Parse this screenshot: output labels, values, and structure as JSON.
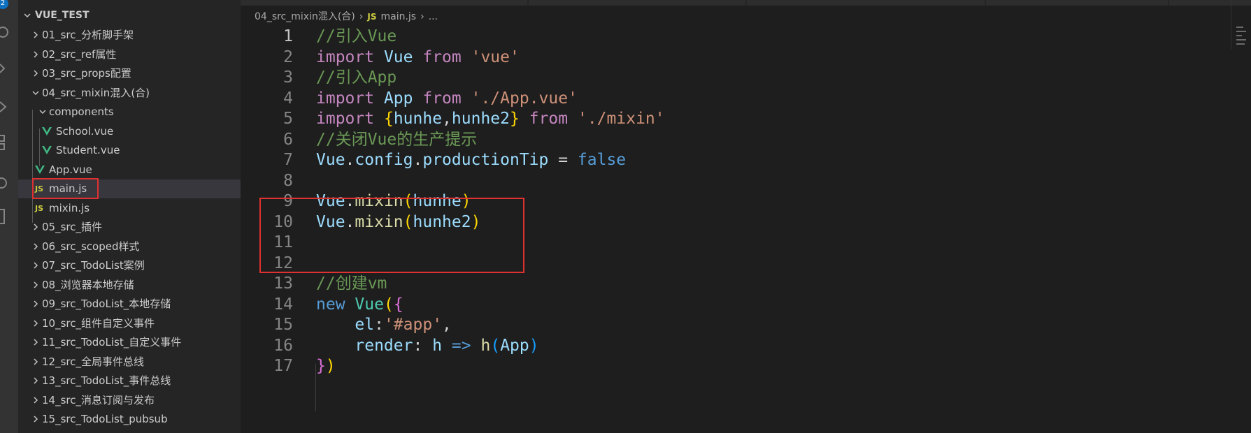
{
  "activity_bar": {
    "badge": "2",
    "icons": [
      "search-icon",
      "source-control-icon",
      "run-debug-icon",
      "extensions-icon",
      "remote-icon",
      "testing-icon"
    ]
  },
  "explorer": {
    "root": "VUE_TEST",
    "items": [
      {
        "label": "01_src_分析脚手架",
        "type": "folder"
      },
      {
        "label": "02_src_ref属性",
        "type": "folder"
      },
      {
        "label": "03_src_props配置",
        "type": "folder"
      },
      {
        "label": "04_src_mixin混入(合)",
        "type": "folder-open"
      },
      {
        "label": "components",
        "type": "folder-open"
      },
      {
        "label": "School.vue",
        "type": "vue"
      },
      {
        "label": "Student.vue",
        "type": "vue"
      },
      {
        "label": "App.vue",
        "type": "vue"
      },
      {
        "label": "main.js",
        "type": "js",
        "selected": true
      },
      {
        "label": "mixin.js",
        "type": "js"
      },
      {
        "label": "05_src_插件",
        "type": "folder"
      },
      {
        "label": "06_src_scoped样式",
        "type": "folder"
      },
      {
        "label": "07_src_TodoList案例",
        "type": "folder"
      },
      {
        "label": "08_浏览器本地存储",
        "type": "folder"
      },
      {
        "label": "09_src_TodoList_本地存储",
        "type": "folder"
      },
      {
        "label": "10_src_组件自定义事件",
        "type": "folder"
      },
      {
        "label": "11_src_TodoList_自定义事件",
        "type": "folder"
      },
      {
        "label": "12_src_全局事件总线",
        "type": "folder"
      },
      {
        "label": "13_src_TodoList_事件总线",
        "type": "folder"
      },
      {
        "label": "14_src_消息订阅与发布",
        "type": "folder"
      },
      {
        "label": "15_src_TodoList_pubsub",
        "type": "folder"
      }
    ],
    "js_icon_text": "JS"
  },
  "breadcrumb": {
    "folder": "04_src_mixin混入(合)",
    "file_icon": "JS",
    "file": "main.js",
    "symbol": "..."
  },
  "editor": {
    "language": "javascript",
    "active_line": "1",
    "line_numbers": [
      "1",
      "2",
      "3",
      "4",
      "5",
      "6",
      "7",
      "8",
      "9",
      "10",
      "11",
      "12",
      "13",
      "14",
      "15",
      "16",
      "17"
    ],
    "lines": [
      [
        {
          "t": "//引入Vue",
          "c": "comment"
        }
      ],
      [
        {
          "t": "import",
          "c": "import"
        },
        {
          "t": " ",
          "c": "plain"
        },
        {
          "t": "Vue",
          "c": "var"
        },
        {
          "t": " ",
          "c": "plain"
        },
        {
          "t": "from",
          "c": "import"
        },
        {
          "t": " ",
          "c": "plain"
        },
        {
          "t": "'vue'",
          "c": "string"
        }
      ],
      [
        {
          "t": "//引入App",
          "c": "comment"
        }
      ],
      [
        {
          "t": "import",
          "c": "import"
        },
        {
          "t": " ",
          "c": "plain"
        },
        {
          "t": "App",
          "c": "var"
        },
        {
          "t": " ",
          "c": "plain"
        },
        {
          "t": "from",
          "c": "import"
        },
        {
          "t": " ",
          "c": "plain"
        },
        {
          "t": "'./App.vue'",
          "c": "string"
        }
      ],
      [
        {
          "t": "import",
          "c": "import"
        },
        {
          "t": " ",
          "c": "plain"
        },
        {
          "t": "{",
          "c": "brace1"
        },
        {
          "t": "hunhe",
          "c": "var"
        },
        {
          "t": ",",
          "c": "plain"
        },
        {
          "t": "hunhe2",
          "c": "var"
        },
        {
          "t": "}",
          "c": "brace1"
        },
        {
          "t": " ",
          "c": "plain"
        },
        {
          "t": "from",
          "c": "import"
        },
        {
          "t": " ",
          "c": "plain"
        },
        {
          "t": "'./mixin'",
          "c": "string"
        }
      ],
      [
        {
          "t": "//关闭Vue的生产提示",
          "c": "comment"
        }
      ],
      [
        {
          "t": "Vue",
          "c": "var"
        },
        {
          "t": ".",
          "c": "plain"
        },
        {
          "t": "config",
          "c": "var"
        },
        {
          "t": ".",
          "c": "plain"
        },
        {
          "t": "productionTip",
          "c": "var"
        },
        {
          "t": " = ",
          "c": "plain"
        },
        {
          "t": "false",
          "c": "bool"
        }
      ],
      [],
      [
        {
          "t": "Vue",
          "c": "var"
        },
        {
          "t": ".",
          "c": "plain"
        },
        {
          "t": "mixin",
          "c": "func"
        },
        {
          "t": "(",
          "c": "brace1"
        },
        {
          "t": "hunhe",
          "c": "var"
        },
        {
          "t": ")",
          "c": "brace1"
        }
      ],
      [
        {
          "t": "Vue",
          "c": "var"
        },
        {
          "t": ".",
          "c": "plain"
        },
        {
          "t": "mixin",
          "c": "func"
        },
        {
          "t": "(",
          "c": "brace1"
        },
        {
          "t": "hunhe2",
          "c": "var"
        },
        {
          "t": ")",
          "c": "brace1"
        }
      ],
      [],
      [],
      [
        {
          "t": "//创建vm",
          "c": "comment"
        }
      ],
      [
        {
          "t": "new",
          "c": "bool"
        },
        {
          "t": " ",
          "c": "plain"
        },
        {
          "t": "Vue",
          "c": "class"
        },
        {
          "t": "(",
          "c": "brace1"
        },
        {
          "t": "{",
          "c": "brace2"
        }
      ],
      [
        {
          "t": "    ",
          "c": "plain"
        },
        {
          "t": "el",
          "c": "var"
        },
        {
          "t": ":",
          "c": "plain"
        },
        {
          "t": "'#app'",
          "c": "string"
        },
        {
          "t": ",",
          "c": "plain"
        }
      ],
      [
        {
          "t": "    ",
          "c": "plain"
        },
        {
          "t": "render",
          "c": "var"
        },
        {
          "t": ": ",
          "c": "plain"
        },
        {
          "t": "h",
          "c": "var"
        },
        {
          "t": " ",
          "c": "plain"
        },
        {
          "t": "=>",
          "c": "bool"
        },
        {
          "t": " ",
          "c": "plain"
        },
        {
          "t": "h",
          "c": "func"
        },
        {
          "t": "(",
          "c": "brace3"
        },
        {
          "t": "App",
          "c": "var"
        },
        {
          "t": ")",
          "c": "brace3"
        }
      ],
      [
        {
          "t": "}",
          "c": "brace2"
        },
        {
          "t": ")",
          "c": "brace1"
        }
      ]
    ]
  },
  "colors": {
    "highlight_box": "#e03131",
    "accent": "#0e70c0"
  }
}
